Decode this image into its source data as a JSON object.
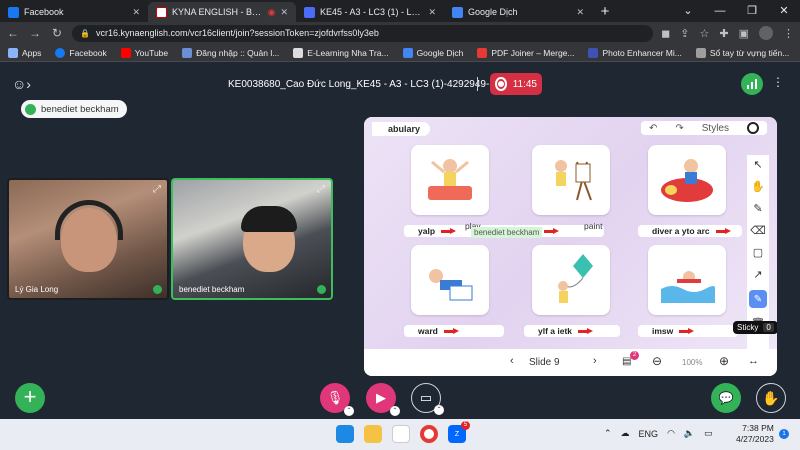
{
  "browser": {
    "tabs": [
      {
        "title": "Facebook",
        "color": "#1877f2",
        "active": false
      },
      {
        "title": "KYNA ENGLISH - BRING MO",
        "color": "#ffffff",
        "active": true
      },
      {
        "title": "KE45 - A3 - LC3 (1) - Lesson Plan",
        "color": "#4a6cf7",
        "active": false
      },
      {
        "title": "Google Dịch",
        "color": "#4285f4",
        "active": false
      }
    ],
    "url": "vcr16.kynaenglish.com/vcr16client/join?sessionToken=zjofdvrfss0ly3eb",
    "bookmarks": [
      {
        "label": "Apps",
        "color": "#8ab4f8"
      },
      {
        "label": "Facebook",
        "color": "#1877f2"
      },
      {
        "label": "YouTube",
        "color": "#ff0000"
      },
      {
        "label": "Đăng nhập :: Quản l...",
        "color": "#6b8fd6"
      },
      {
        "label": "E-Learning Nha Tra...",
        "color": "#dddddd"
      },
      {
        "label": "Google Dịch",
        "color": "#4285f4"
      },
      {
        "label": "PDF Joiner – Merge...",
        "color": "#e53935"
      },
      {
        "label": "Photo Enhancer Mi...",
        "color": "#3f51b5"
      },
      {
        "label": "Sổ tay từ vựng tiến...",
        "color": "#9e9e9e"
      }
    ]
  },
  "app": {
    "session_title": "KE0038680_Cao Đức Long_KE45 - A3 - LC3 (1)-4292949-...",
    "timer": "11:45",
    "spotlight_name": "benediet beckham",
    "videos": [
      {
        "name": "Lý Gia Long"
      },
      {
        "name": "benediet beckham"
      }
    ]
  },
  "board": {
    "section_title": "abulary",
    "styles_label": "Styles",
    "words": [
      "yalp",
      "pit",
      "diver a yto arc",
      "ward",
      "ylf a ietk",
      "imsw"
    ],
    "answers": [
      "play",
      "paint"
    ],
    "name_tag": "benediet beckham",
    "sticky_label": "Sticky",
    "sticky_shortcut": "0",
    "page_badge": "9",
    "slide_label": "Slide 9",
    "layers_count": "2",
    "zoom": "100%"
  },
  "taskbar": {
    "lang": "ENG",
    "time": "7:38 PM",
    "date": "4/27/2023",
    "zalo_badge": "5",
    "notif_count": "1"
  }
}
